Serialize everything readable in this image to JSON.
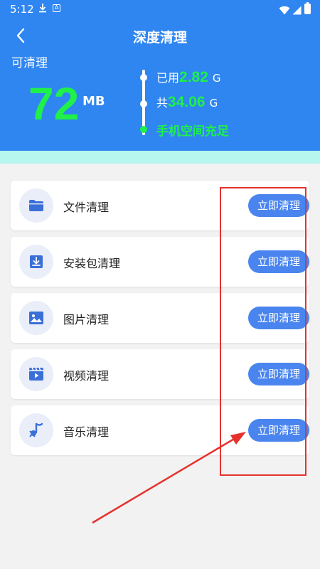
{
  "status_bar": {
    "time": "5:12",
    "download_icon": "download-icon",
    "a_icon": "A"
  },
  "header": {
    "back_icon": "back-chevron-icon",
    "title": "深度清理",
    "cleanable_label": "可清理",
    "cleanable_size": "72",
    "cleanable_unit": "MB",
    "used_label": "已用",
    "used_value": "2.82",
    "used_unit": "G",
    "total_label": "共",
    "total_value": "34.06",
    "total_unit": "G",
    "space_status": "手机空间充足"
  },
  "items": [
    {
      "label": "文件清理",
      "button": "立即清理",
      "icon": "folder-icon"
    },
    {
      "label": "安装包清理",
      "button": "立即清理",
      "icon": "package-download-icon"
    },
    {
      "label": "图片清理",
      "button": "立即清理",
      "icon": "image-icon"
    },
    {
      "label": "视频清理",
      "button": "立即清理",
      "icon": "video-icon"
    },
    {
      "label": "音乐清理",
      "button": "立即清理",
      "icon": "music-icon"
    }
  ],
  "colors": {
    "header_bg": "#2f86f0",
    "accent_green": "#1ff04a",
    "button_blue": "#4a85ef",
    "annotation_red": "#e5322d",
    "mint_strip": "#b7f6ee"
  }
}
